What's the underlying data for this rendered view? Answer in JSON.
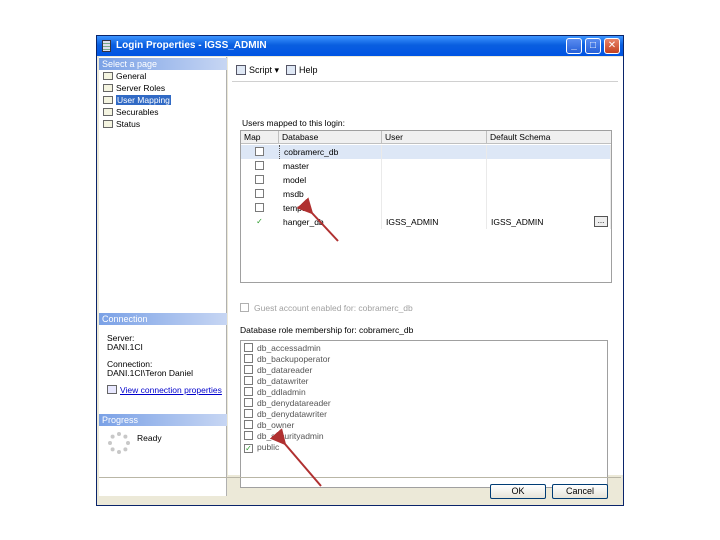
{
  "window": {
    "title": "Login Properties - IGSS_ADMIN"
  },
  "titlebar_buttons": {
    "minimize": "_",
    "maximize": "□",
    "close": "✕"
  },
  "left_panel": {
    "select_page_header": "Select a page",
    "pages": [
      {
        "label": "General",
        "icon": "page-icon",
        "selected": false
      },
      {
        "label": "Server Roles",
        "icon": "page-icon",
        "selected": false
      },
      {
        "label": "User Mapping",
        "icon": "page-icon",
        "selected": true
      },
      {
        "label": "Securables",
        "icon": "page-icon",
        "selected": false
      },
      {
        "label": "Status",
        "icon": "page-icon",
        "selected": false
      }
    ],
    "connection_header": "Connection",
    "server_label": "Server:",
    "server_value": "DANI.1CI",
    "connection_label": "Connection:",
    "connection_value": "DANI.1CI\\Teron Daniel",
    "view_link": "View connection properties",
    "progress_header": "Progress",
    "progress_status": "Ready"
  },
  "toolbar": {
    "script_label": "Script",
    "script_dropdown": "▾",
    "help_label": "Help"
  },
  "user_mapping": {
    "grid_caption": "Users mapped to this login:",
    "columns": [
      "Map",
      "Database",
      "User",
      "Default Schema"
    ],
    "rows": [
      {
        "map": false,
        "database": "cobramerc_db",
        "user": "",
        "schema": "",
        "selected": true
      },
      {
        "map": false,
        "database": "master",
        "user": "",
        "schema": "",
        "selected": false
      },
      {
        "map": false,
        "database": "model",
        "user": "",
        "schema": "",
        "selected": false
      },
      {
        "map": false,
        "database": "msdb",
        "user": "",
        "schema": "",
        "selected": false
      },
      {
        "map": false,
        "database": "tempdb",
        "user": "",
        "schema": "",
        "selected": false
      },
      {
        "map": true,
        "database": "hanger_db",
        "user": "IGSS_ADMIN",
        "schema": "IGSS_ADMIN",
        "selected": false
      }
    ],
    "browse_button": "...",
    "guest_label": "Guest account enabled for: cobramerc_db",
    "role_caption": "Database role membership for: cobramerc_db",
    "roles": [
      {
        "label": "db_accessadmin",
        "checked": false
      },
      {
        "label": "db_backupoperator",
        "checked": false
      },
      {
        "label": "db_datareader",
        "checked": false
      },
      {
        "label": "db_datawriter",
        "checked": false
      },
      {
        "label": "db_ddladmin",
        "checked": false
      },
      {
        "label": "db_denydatareader",
        "checked": false
      },
      {
        "label": "db_denydatawriter",
        "checked": false
      },
      {
        "label": "db_owner",
        "checked": false
      },
      {
        "label": "db_securityadmin",
        "checked": false
      },
      {
        "label": "public",
        "checked": true
      }
    ]
  },
  "buttons": {
    "ok": "OK",
    "cancel": "Cancel"
  },
  "colors": {
    "titlebar": "#0054e3",
    "section_header": "#7aa1e6",
    "selection": "#316ac5",
    "arrow": "#b03030",
    "check": "#2a9a2a"
  }
}
